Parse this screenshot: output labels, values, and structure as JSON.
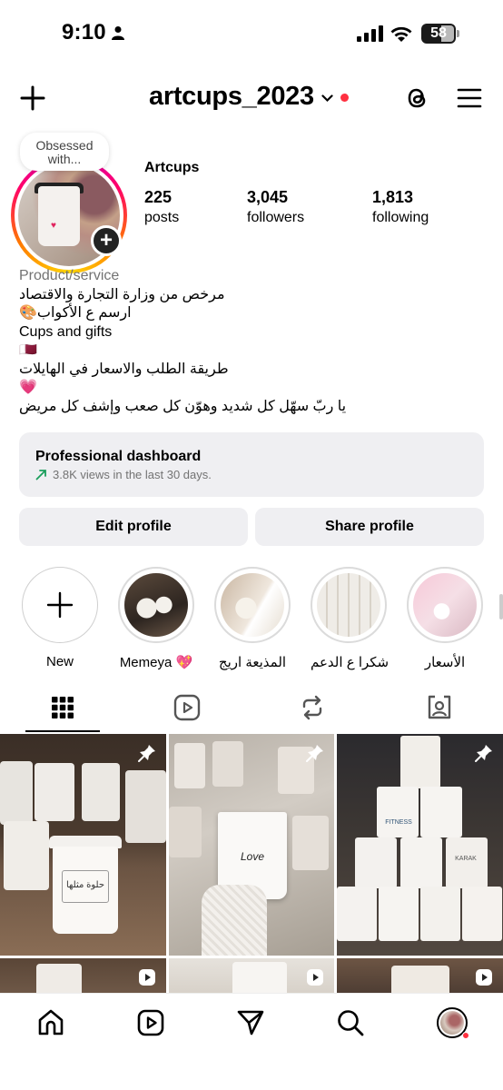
{
  "status_bar": {
    "time": "9:10",
    "battery": "58"
  },
  "header": {
    "username": "artcups_2023"
  },
  "profile": {
    "note": "Obsessed with...",
    "display_name": "Artcups",
    "stats": [
      {
        "value": "225",
        "label": "posts"
      },
      {
        "value": "3,045",
        "label": "followers"
      },
      {
        "value": "1,813",
        "label": "following"
      }
    ],
    "bio": {
      "category": "Product/service",
      "lines": [
        "مرخص من وزارة التجارة والاقتصاد",
        "ارسم ع الأكواب🎨",
        "Cups and gifts",
        "🇶🇦",
        "طريقة الطلب والاسعار في الهايلات",
        "💗",
        "يا ربّ سهّل كل شديد وهوّن كل صعب وإشف كل مريض"
      ]
    }
  },
  "dashboard": {
    "title": "Professional dashboard",
    "subtitle": "3.8K views in the last 30 days."
  },
  "buttons": {
    "edit": "Edit profile",
    "share": "Share profile"
  },
  "highlights": [
    {
      "label": "New"
    },
    {
      "label": "Memeya 💖"
    },
    {
      "label": "المذيعة اريج"
    },
    {
      "label": "شكرا ع الدعم"
    },
    {
      "label": "الأسعار"
    }
  ],
  "grid_post_text": {
    "post1": "حلوة مثلها",
    "post2": "Love",
    "post3_a": "FITNESS",
    "post3_b": "KARAK"
  },
  "colors": {
    "accent_red": "#ff3040",
    "button_bg": "#efeff2",
    "secondary_text": "#737373",
    "trend_green": "#1a9e5c"
  },
  "icons": [
    "add-icon",
    "chevron-down-icon",
    "threads-icon",
    "hamburger-menu-icon",
    "grid-icon",
    "reels-icon",
    "reposts-icon",
    "tagged-icon",
    "pin-icon",
    "reel-badge-icon",
    "home-icon",
    "send-icon",
    "search-icon"
  ]
}
